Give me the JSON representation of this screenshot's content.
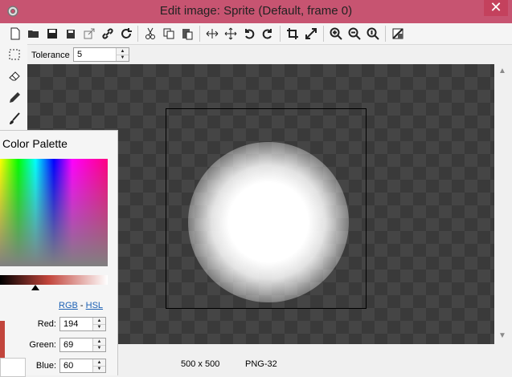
{
  "window": {
    "title": "Edit image: Sprite (Default, frame 0)",
    "close_label": "✕"
  },
  "toolbar": {
    "buttons": [
      {
        "name": "new-icon"
      },
      {
        "name": "open-icon"
      },
      {
        "name": "save-icon"
      },
      {
        "name": "save-as-icon"
      },
      {
        "name": "export-icon"
      },
      {
        "name": "link-icon"
      },
      {
        "name": "refresh-icon"
      },
      {
        "name": "cut-icon"
      },
      {
        "name": "copy-icon"
      },
      {
        "name": "paste-icon"
      },
      {
        "name": "flip-horizontal-icon"
      },
      {
        "name": "move-icon"
      },
      {
        "name": "undo-icon"
      },
      {
        "name": "redo-icon"
      },
      {
        "name": "crop-icon"
      },
      {
        "name": "resize-icon"
      },
      {
        "name": "zoom-in-icon"
      },
      {
        "name": "zoom-out-icon"
      },
      {
        "name": "zoom-reset-icon"
      },
      {
        "name": "grid-icon"
      }
    ]
  },
  "tools": [
    {
      "name": "select-tool-icon"
    },
    {
      "name": "eraser-tool-icon"
    },
    {
      "name": "pencil-tool-icon"
    },
    {
      "name": "brush-tool-icon"
    }
  ],
  "options": {
    "tolerance_label": "Tolerance",
    "tolerance_value": "5"
  },
  "status": {
    "size": "500 x 500",
    "format": "PNG-32"
  },
  "palette": {
    "title": "Color Palette",
    "link_rgb": "RGB",
    "link_sep": "-",
    "link_hsl": "HSL",
    "red_label": "Red:",
    "red_value": "194",
    "green_label": "Green:",
    "green_value": "69",
    "blue_label": "Blue:",
    "blue_value": "60",
    "current_color": "#c2453c"
  },
  "colors": {
    "titlebar": "#c75471",
    "canvas_dark": "#3a3a3a",
    "canvas_light": "#454545"
  }
}
